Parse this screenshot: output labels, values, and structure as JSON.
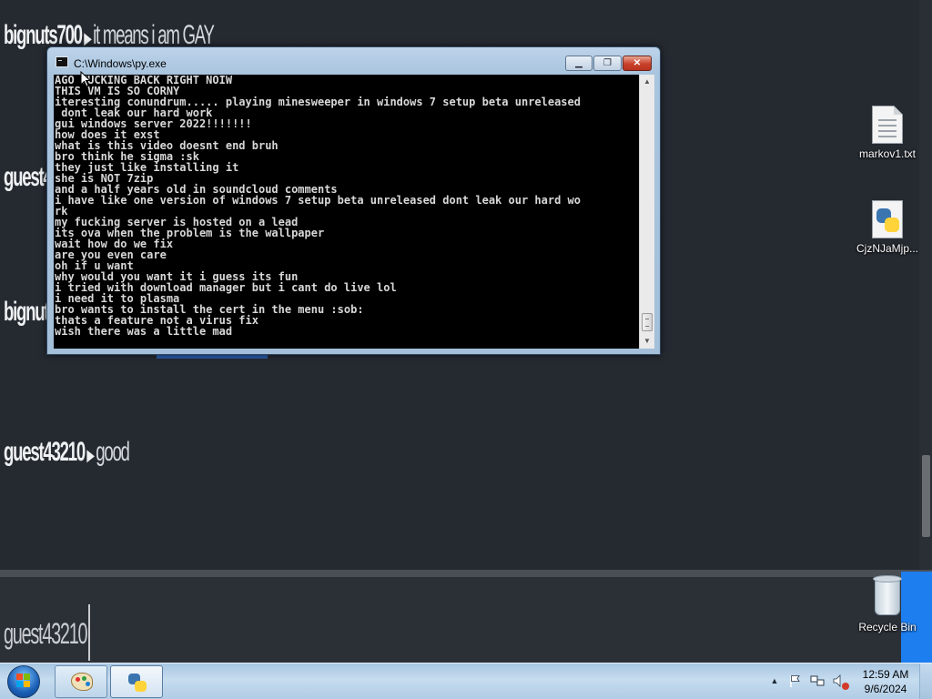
{
  "wallpaper": {
    "chat": [
      {
        "user": "bignuts700",
        "msg": "it means i am GAY"
      },
      {
        "user": "guest43",
        "msg": ""
      },
      {
        "user": "bignuts",
        "msg": ""
      },
      {
        "user": "guest43210",
        "msg": "good"
      }
    ],
    "input_user": "guest43210"
  },
  "desktop": {
    "icons": [
      {
        "label": "markov1.txt",
        "icon": "text-file-icon"
      },
      {
        "label": "CjzNJaMjp...",
        "icon": "python-file-icon"
      },
      {
        "label": "Recycle Bin",
        "icon": "recycle-bin-icon"
      }
    ]
  },
  "window": {
    "title": "C:\\Windows\\py.exe",
    "min_glyph": "▁",
    "max_glyph": "❐",
    "close_glyph": "✕",
    "console_lines": [
      "AGO FUCKING BACK RIGHT NOIW",
      "THIS VM IS SO CORNY",
      "iteresting conundrum..... playing minesweeper in windows 7 setup beta unreleased",
      " dont leak our hard work",
      "gui windows server 2022!!!!!!!",
      "how does it exst",
      "what is this video doesnt end bruh",
      "bro think he sigma :sk",
      "they just like installing it",
      "she is NOT 7zip",
      "and a half years old in soundcloud comments",
      "i have like one version of windows 7 setup beta unreleased dont leak our hard wo",
      "rk",
      "my fucking server is hosted on a lead",
      "its ova when the problem is the wallpaper",
      "wait how do we fix",
      "are you even care",
      "oh if u want",
      "why would you want it i guess its fun",
      "i tried with download manager but i cant do live lol",
      "i need it to plasma",
      "bro wants to install the cert in the menu :sob:",
      "thats a feature not a virus fix",
      "wish there was a little mad"
    ],
    "scroll_up": "▲",
    "scroll_down": "▼"
  },
  "taskbar": {
    "tray_chevron": "▲",
    "clock_time": "12:59 AM",
    "clock_date": "9/6/2024"
  }
}
